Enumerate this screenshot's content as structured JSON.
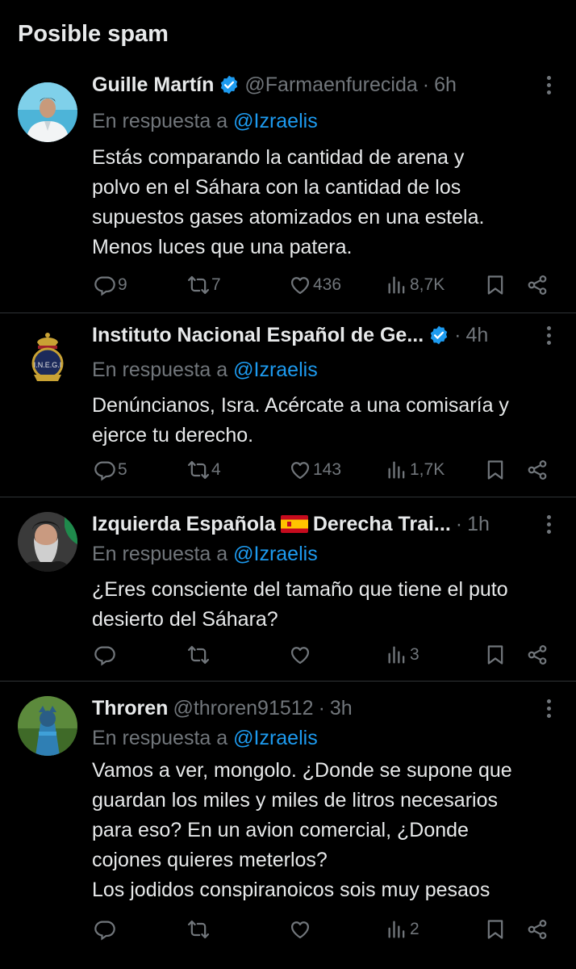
{
  "page": {
    "title": "Posible spam"
  },
  "replies": [
    {
      "name": "Guille Martín",
      "verified": true,
      "handle": "@Farmaenfurecida",
      "time": "6h",
      "reply_prefix": "En respuesta a",
      "reply_to": "@Izraelis",
      "lines": [
        "Estás comparando la cantidad de arena y",
        "polvo en el Sáhara con la cantidad de los",
        "supuestos gases atomizados en una estela.",
        "Menos luces que una patera."
      ],
      "replies_count": "9",
      "reposts": "7",
      "likes": "436",
      "views": "8,7K"
    },
    {
      "name": "Instituto Nacional Español de Ge...",
      "verified": true,
      "handle": "",
      "time": "4h",
      "reply_prefix": "En respuesta a",
      "reply_to": "@Izraelis",
      "lines": [
        "Denúncianos, Isra. Acércate a una comisaría y",
        "ejerce tu derecho."
      ],
      "replies_count": "5",
      "reposts": "4",
      "likes": "143",
      "views": "1,7K"
    },
    {
      "name_part1": "Izquierda Española",
      "flag": "spain-flag",
      "name_part2": "Derecha Trai...",
      "time": "1h",
      "reply_prefix": "En respuesta a",
      "reply_to": "@Izraelis",
      "lines": [
        "¿Eres consciente del tamaño que tiene el puto",
        "desierto del Sáhara?"
      ],
      "replies_count": "",
      "reposts": "",
      "likes": "",
      "views": "3"
    },
    {
      "name": "Throren",
      "handle": "@throren91512",
      "time": "3h",
      "reply_prefix": "En respuesta a",
      "reply_to": "@Izraelis",
      "lines": [
        "Vamos a ver, mongolo. ¿Donde se supone que",
        "guardan los miles y miles de litros necesarios",
        "para eso? En un avion comercial, ¿Donde",
        "cojones quieres meterlos?",
        "Los jodidos conspiranoicos sois muy pesaos"
      ],
      "replies_count": "",
      "reposts": "",
      "likes": "",
      "views": "2"
    }
  ],
  "separator": "·",
  "icons": [
    "reply-icon",
    "repost-icon",
    "like-icon",
    "views-icon",
    "bookmark-icon",
    "share-icon",
    "more-icon",
    "verified-icon"
  ],
  "colors": {
    "background": "#000000",
    "text": "#e7e9ea",
    "muted": "#71767b",
    "accent": "#1d9bf0",
    "divider": "#2f3336"
  }
}
